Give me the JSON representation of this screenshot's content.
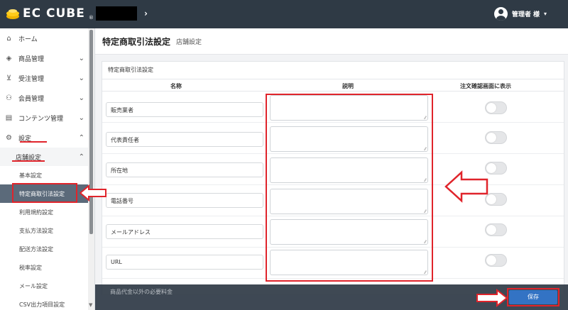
{
  "header": {
    "logo_text": "EC CUBE",
    "logo_tm": "®",
    "breadcrumb_chevron": "›",
    "user_label": "管理者 様",
    "user_caret": "▾"
  },
  "sidebar": {
    "items": [
      {
        "label": "ホーム",
        "icon": "home-icon",
        "glyph": "⌂"
      },
      {
        "label": "商品管理",
        "icon": "box-icon",
        "glyph": "◈",
        "caret": "⌄"
      },
      {
        "label": "受注管理",
        "icon": "cart-icon",
        "glyph": "⊻",
        "caret": "⌄"
      },
      {
        "label": "会員管理",
        "icon": "users-icon",
        "glyph": "⚇",
        "caret": "⌄"
      },
      {
        "label": "コンテンツ管理",
        "icon": "document-icon",
        "glyph": "▤",
        "caret": "⌄"
      },
      {
        "label": "設定",
        "icon": "gear-icon",
        "glyph": "⚙",
        "caret": "⌃"
      }
    ],
    "sub": {
      "label": "店舗設定",
      "caret": "⌃"
    },
    "leaves": [
      "基本設定",
      "特定商取引法設定",
      "利用規約設定",
      "支払方法設定",
      "配送方法設定",
      "税率設定",
      "メール設定",
      "CSV出力項目設定"
    ],
    "scroll_down": "▼"
  },
  "page": {
    "title": "特定商取引法設定",
    "subtitle": "店舗設定"
  },
  "card": {
    "title": "特定商取引法設定",
    "columns": {
      "name": "名称",
      "description": "説明",
      "show_on_confirm": "注文確認画面に表示"
    },
    "rows": [
      "販売業者",
      "代表責任者",
      "所在地",
      "電話番号",
      "メールアドレス",
      "URL"
    ]
  },
  "bottom": {
    "peek_text": "商品代金以外の必要料金",
    "save_label": "保存"
  },
  "colors": {
    "topbar": "#2f3a45",
    "accent": "#3373c4",
    "annotation": "#e0242b"
  }
}
